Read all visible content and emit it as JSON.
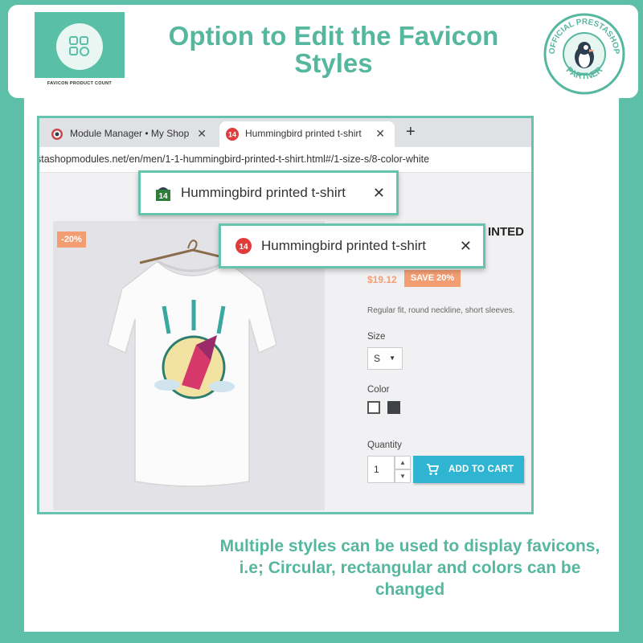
{
  "header": {
    "title": "Option to Edit the Favicon Styles",
    "logo_label": "FAVICON PRODUCT COUNT",
    "badge_top": "OFFICIAL PRESTASHOP",
    "badge_bottom": "PARTNER"
  },
  "browser": {
    "tabs": [
      {
        "label": "Module Manager • My Shop",
        "active": false
      },
      {
        "label": "Hummingbird printed t-shirt",
        "active": true
      }
    ],
    "new_tab": "+",
    "close_glyph": "✕",
    "address": "stashopmodules.net/en/men/1-1-hummingbird-printed-t-shirt.html#/1-size-s/8-color-white"
  },
  "callouts": [
    {
      "label": "Hummingbird printed t-shirt",
      "favicon_count": "14",
      "favicon_style": "rectangular",
      "favicon_color": "#2e7d3a"
    },
    {
      "label": "Hummingbird printed t-shirt",
      "favicon_count": "14",
      "favicon_style": "circular",
      "favicon_color": "#e23b3b"
    }
  ],
  "product": {
    "discount_flag": "-20%",
    "title_fragment": "INTED",
    "price": "$19.12",
    "save_badge": "SAVE 20%",
    "description": "Regular fit, round neckline, short sleeves.",
    "size_label": "Size",
    "size_value": "S",
    "color_label": "Color",
    "colors": [
      "#ffffff",
      "#3f4347"
    ],
    "quantity_label": "Quantity",
    "quantity_value": "1",
    "add_to_cart": "ADD TO CART"
  },
  "footer": {
    "text": "Multiple styles can be used to display favicons, i.e; Circular, rectangular and colors can be changed"
  },
  "colors": {
    "accent": "#56b79f",
    "border": "#67c3ad",
    "price": "#f39d72",
    "cart_button": "#2fb5d2"
  }
}
